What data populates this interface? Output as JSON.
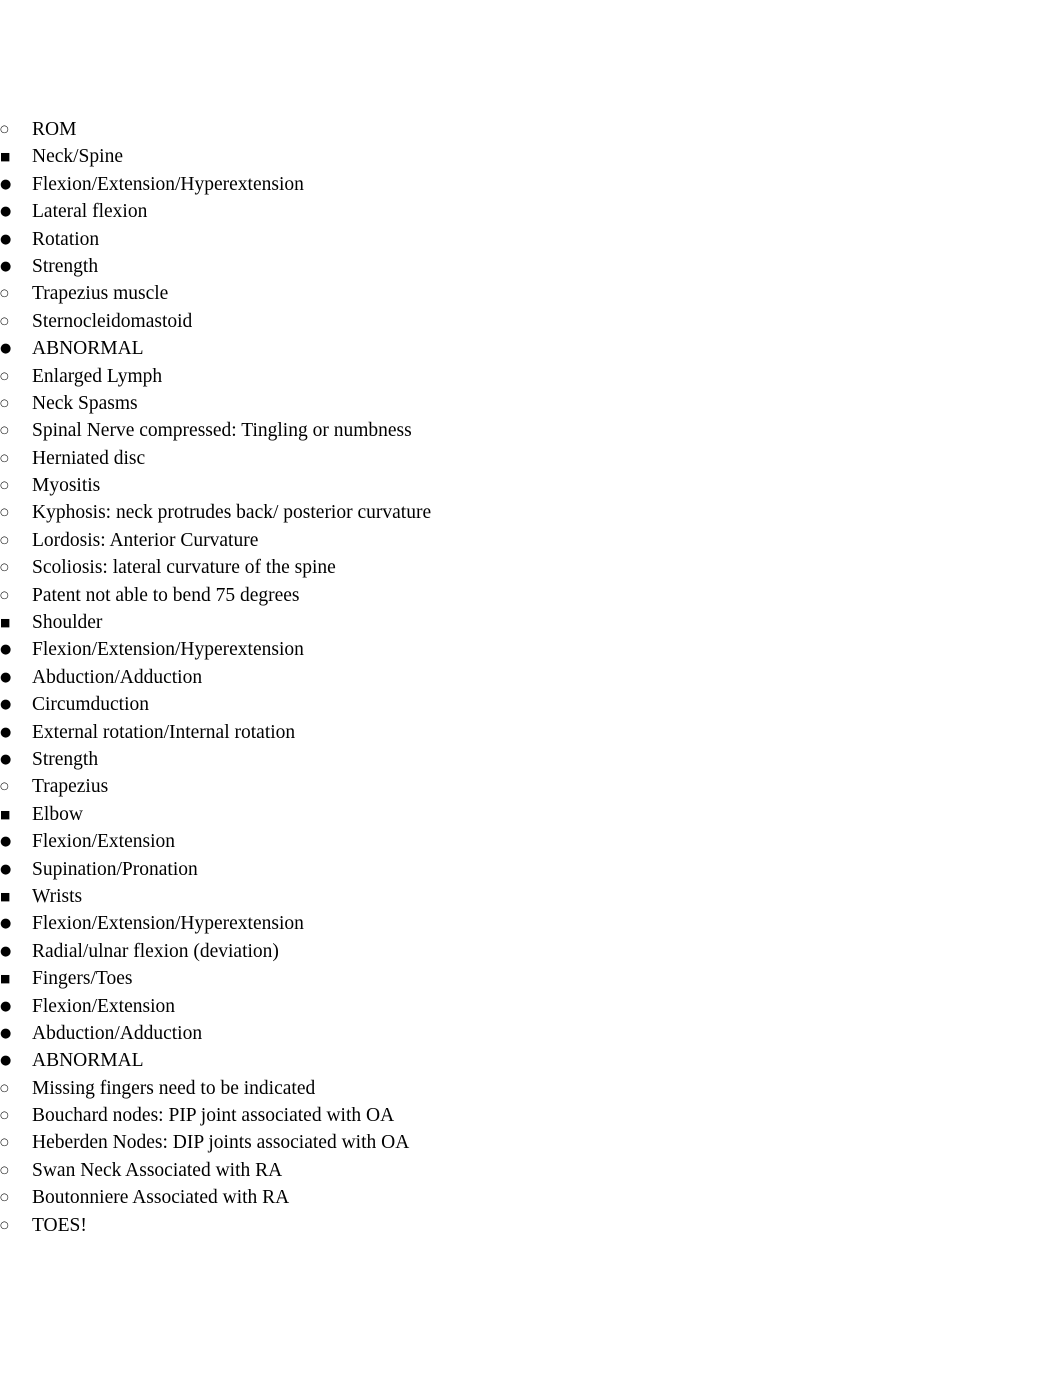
{
  "document": {
    "title": "ROM",
    "background_color": "#ffffff",
    "text_color": "#000000"
  },
  "markers": {
    "level1": "○",
    "level2": "■",
    "level3": "●",
    "level4": "○"
  },
  "outline": [
    {
      "id": "rom",
      "label": "ROM",
      "level": 1,
      "children": [
        {
          "id": "neck-spine",
          "label": "Neck/Spine",
          "level": 2,
          "children": [
            {
              "id": "neck-flexion",
              "label": "Flexion/Extension/Hyperextension",
              "level": 3
            },
            {
              "id": "neck-lateral-flexion",
              "label": "Lateral flexion",
              "level": 3
            },
            {
              "id": "neck-rotation",
              "label": "Rotation",
              "level": 3
            },
            {
              "id": "neck-strength",
              "label": "Strength",
              "level": 3,
              "children": [
                {
                  "id": "trapezius-muscle",
                  "label": "Trapezius muscle",
                  "level": 4
                },
                {
                  "id": "sternocleidomastoid",
                  "label": "Sternocleidomastoid",
                  "level": 4
                }
              ]
            },
            {
              "id": "neck-abnormal",
              "label": "ABNORMAL",
              "level": 3,
              "children": [
                {
                  "id": "enlarged-lymph",
                  "label": "Enlarged Lymph",
                  "level": 4
                },
                {
                  "id": "neck-spasms",
                  "label": "Neck Spasms",
                  "level": 4
                },
                {
                  "id": "spinal-nerve-compressed",
                  "label": "Spinal Nerve compressed: Tingling or numbness",
                  "level": 4
                },
                {
                  "id": "herniated-disc",
                  "label": "Herniated disc",
                  "level": 4
                },
                {
                  "id": "myositis",
                  "label": "Myositis",
                  "level": 4
                },
                {
                  "id": "kyphosis",
                  "label": "Kyphosis: neck protrudes back/ posterior curvature",
                  "level": 4
                },
                {
                  "id": "lordosis",
                  "label": "Lordosis: Anterior Curvature",
                  "level": 4
                },
                {
                  "id": "scoliosis",
                  "label": "Scoliosis: lateral curvature of the spine",
                  "level": 4
                },
                {
                  "id": "patent-bend-75",
                  "label": "Patent not able to bend 75 degrees",
                  "level": 4
                }
              ]
            }
          ]
        },
        {
          "id": "shoulder",
          "label": "Shoulder",
          "level": 2,
          "children": [
            {
              "id": "shoulder-flexion",
              "label": "Flexion/Extension/Hyperextension",
              "level": 3
            },
            {
              "id": "shoulder-abduction",
              "label": "Abduction/Adduction",
              "level": 3
            },
            {
              "id": "shoulder-circumduction",
              "label": "Circumduction",
              "level": 3
            },
            {
              "id": "shoulder-rotation",
              "label": "External rotation/Internal rotation",
              "level": 3
            },
            {
              "id": "shoulder-strength",
              "label": "Strength",
              "level": 3,
              "children": [
                {
                  "id": "shoulder-trapezius",
                  "label": "Trapezius",
                  "level": 4
                }
              ]
            }
          ]
        },
        {
          "id": "elbow",
          "label": "Elbow",
          "level": 2,
          "children": [
            {
              "id": "elbow-flexion",
              "label": "Flexion/Extension",
              "level": 3
            },
            {
              "id": "elbow-supination",
              "label": "Supination/Pronation",
              "level": 3
            }
          ]
        },
        {
          "id": "wrists",
          "label": "Wrists",
          "level": 2,
          "children": [
            {
              "id": "wrists-flexion",
              "label": "Flexion/Extension/Hyperextension",
              "level": 3
            },
            {
              "id": "wrists-radial-ulnar",
              "label": "Radial/ulnar flexion (deviation)",
              "level": 3
            }
          ]
        },
        {
          "id": "fingers-toes",
          "label": "Fingers/Toes",
          "level": 2,
          "children": [
            {
              "id": "fingers-flexion",
              "label": "Flexion/Extension",
              "level": 3
            },
            {
              "id": "fingers-abduction",
              "label": "Abduction/Adduction",
              "level": 3
            },
            {
              "id": "fingers-abnormal",
              "label": "ABNORMAL",
              "level": 3,
              "children": [
                {
                  "id": "missing-fingers",
                  "label": "Missing fingers need to be indicated",
                  "level": 4
                },
                {
                  "id": "bouchard-nodes",
                  "label": "Bouchard nodes: PIP joint associated with OA",
                  "level": 4
                },
                {
                  "id": "heberden-nodes",
                  "label": "Heberden Nodes: DIP joints associated with OA",
                  "level": 4
                },
                {
                  "id": "swan-neck",
                  "label": "Swan Neck Associated with RA",
                  "level": 4
                },
                {
                  "id": "boutonniere",
                  "label": "Boutonniere Associated with RA",
                  "level": 4
                },
                {
                  "id": "toes",
                  "label": "TOES!",
                  "level": 4
                }
              ]
            }
          ]
        }
      ]
    }
  ]
}
